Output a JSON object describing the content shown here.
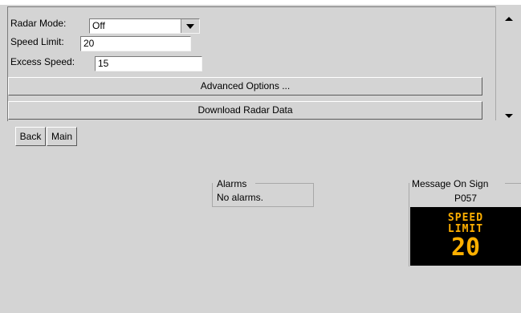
{
  "radar": {
    "mode_label": "Radar Mode:",
    "mode_value": "Off",
    "speed_limit_label": "Speed Limit:",
    "speed_limit_value": "20",
    "excess_speed_label": "Excess Speed:",
    "excess_speed_value": "15",
    "advanced_options_label": "Advanced Options ...",
    "download_label": "Download Radar Data"
  },
  "nav": {
    "back_label": "Back",
    "main_label": "Main"
  },
  "alarms": {
    "title": "Alarms",
    "text": "No alarms."
  },
  "sign": {
    "title": "Message On Sign",
    "id": "P057",
    "line1": "SPEED",
    "line2": "LIMIT",
    "line3": "20",
    "text_color": "#ffb000",
    "background_color": "#000000"
  },
  "icons": {
    "dropdown": "chevron-down-icon",
    "scroll_up": "arrow-up-icon",
    "scroll_down": "arrow-down-icon"
  }
}
